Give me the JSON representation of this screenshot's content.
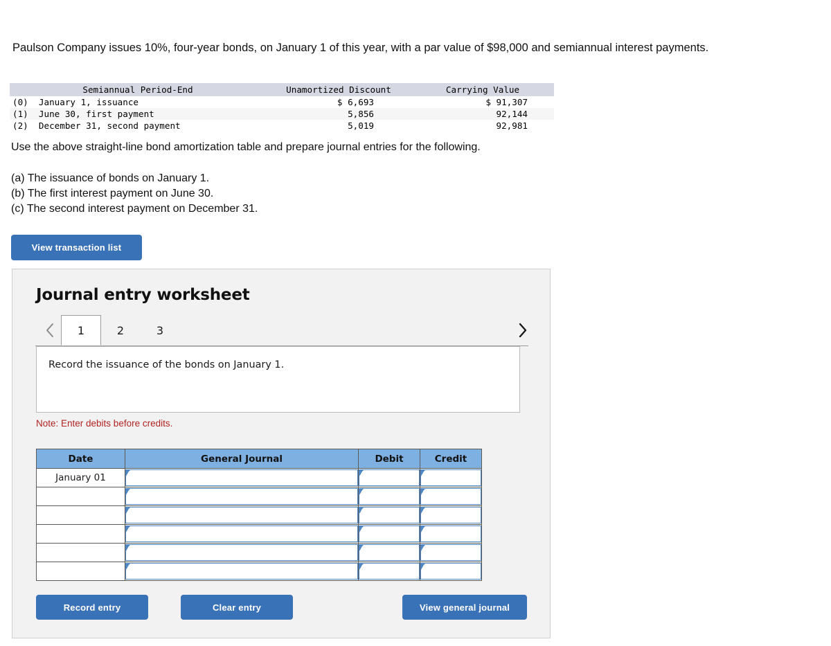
{
  "problem": {
    "statement": "Paulson Company issues 10%, four-year bonds, on January 1 of this year, with a par value of $98,000 and semiannual interest payments.",
    "instruction": "Use the above straight-line bond amortization table and prepare journal entries for the following.",
    "requirements": [
      "(a) The issuance of bonds on January 1.",
      "(b) The first interest payment on June 30.",
      "(c) The second interest payment on December 31."
    ]
  },
  "amortization_table": {
    "headers": [
      "Semiannual Period-End",
      "Unamortized Discount",
      "Carrying Value"
    ],
    "rows": [
      {
        "index": "(0)",
        "period": "January 1, issuance",
        "discount": "$ 6,693",
        "carrying": "$ 91,307"
      },
      {
        "index": "(1)",
        "period": "June 30, first payment",
        "discount": "5,856",
        "carrying": "92,144"
      },
      {
        "index": "(2)",
        "period": "December 31, second payment",
        "discount": "5,019",
        "carrying": "92,981"
      }
    ]
  },
  "toolbar": {
    "view_transaction_list_label": "View transaction list"
  },
  "worksheet": {
    "title": "Journal entry worksheet",
    "tabs": [
      {
        "label": "1",
        "active": true
      },
      {
        "label": "2",
        "active": false
      },
      {
        "label": "3",
        "active": false
      }
    ],
    "prev_arrow": "chevron-left",
    "next_arrow": "chevron-right",
    "prompt": "Record the issuance of the bonds on January 1.",
    "note": "Note: Enter debits before credits.",
    "journal": {
      "columns": [
        "Date",
        "General Journal",
        "Debit",
        "Credit"
      ],
      "rows": [
        {
          "date": "January 01",
          "general_journal": "",
          "debit": "",
          "credit": ""
        },
        {
          "date": "",
          "general_journal": "",
          "debit": "",
          "credit": ""
        },
        {
          "date": "",
          "general_journal": "",
          "debit": "",
          "credit": ""
        },
        {
          "date": "",
          "general_journal": "",
          "debit": "",
          "credit": ""
        },
        {
          "date": "",
          "general_journal": "",
          "debit": "",
          "credit": ""
        },
        {
          "date": "",
          "general_journal": "",
          "debit": "",
          "credit": ""
        }
      ]
    },
    "buttons": {
      "record_entry": "Record entry",
      "clear_entry": "Clear entry",
      "view_general_journal": "View general journal"
    }
  },
  "colors": {
    "button_blue": "#3a72b8",
    "table_header_blue": "#7eb0e2",
    "amort_header_bg": "#d5d8e2",
    "note_red": "#b22222",
    "panel_bg": "#f2f2f2",
    "input_border_blue": "#4f87c4"
  }
}
